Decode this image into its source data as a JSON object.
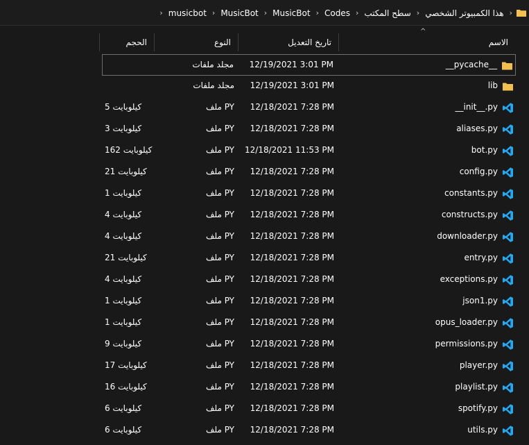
{
  "breadcrumb": {
    "items": [
      "هذا الكمبيوتر الشخصي",
      "سطح المكتب",
      "Codes",
      "MusicBot",
      "MusicBot",
      "musicbot"
    ],
    "separator": "›",
    "trailing_chevron": "›"
  },
  "columns": {
    "name": "الاسم",
    "date": "تاريخ التعديل",
    "type": "النوع",
    "size": "الحجم",
    "sort_indicator": "^"
  },
  "colors": {
    "background": "#191919",
    "folder": "#f2c14e",
    "vscode_blue": "#23a9f2",
    "selection_border": "#707070"
  },
  "files": [
    {
      "name": "__pycache__",
      "date": "12/19/2021 3:01 PM",
      "type": "مجلد ملفات",
      "size": "",
      "icon": "folder-icon",
      "selected": true
    },
    {
      "name": "lib",
      "date": "12/19/2021 3:01 PM",
      "type": "مجلد ملفات",
      "size": "",
      "icon": "folder-icon"
    },
    {
      "name": "__init__.py",
      "date": "12/18/2021 7:28 PM",
      "type": "ملف PY",
      "size": "5 كيلوبايت",
      "icon": "vscode-file-icon"
    },
    {
      "name": "aliases.py",
      "date": "12/18/2021 7:28 PM",
      "type": "ملف PY",
      "size": "3 كيلوبايت",
      "icon": "vscode-file-icon"
    },
    {
      "name": "bot.py",
      "date": "12/18/2021 11:53 PM",
      "type": "ملف PY",
      "size": "162 كيلوبايت",
      "icon": "vscode-file-icon"
    },
    {
      "name": "config.py",
      "date": "12/18/2021 7:28 PM",
      "type": "ملف PY",
      "size": "21 كيلوبايت",
      "icon": "vscode-file-icon"
    },
    {
      "name": "constants.py",
      "date": "12/18/2021 7:28 PM",
      "type": "ملف PY",
      "size": "1 كيلوبايت",
      "icon": "vscode-file-icon"
    },
    {
      "name": "constructs.py",
      "date": "12/18/2021 7:28 PM",
      "type": "ملف PY",
      "size": "4 كيلوبايت",
      "icon": "vscode-file-icon"
    },
    {
      "name": "downloader.py",
      "date": "12/18/2021 7:28 PM",
      "type": "ملف PY",
      "size": "4 كيلوبايت",
      "icon": "vscode-file-icon"
    },
    {
      "name": "entry.py",
      "date": "12/18/2021 7:28 PM",
      "type": "ملف PY",
      "size": "21 كيلوبايت",
      "icon": "vscode-file-icon"
    },
    {
      "name": "exceptions.py",
      "date": "12/18/2021 7:28 PM",
      "type": "ملف PY",
      "size": "4 كيلوبايت",
      "icon": "vscode-file-icon"
    },
    {
      "name": "json1.py",
      "date": "12/18/2021 7:28 PM",
      "type": "ملف PY",
      "size": "1 كيلوبايت",
      "icon": "vscode-file-icon"
    },
    {
      "name": "opus_loader.py",
      "date": "12/18/2021 7:28 PM",
      "type": "ملف PY",
      "size": "1 كيلوبايت",
      "icon": "vscode-file-icon"
    },
    {
      "name": "permissions.py",
      "date": "12/18/2021 7:28 PM",
      "type": "ملف PY",
      "size": "9 كيلوبايت",
      "icon": "vscode-file-icon"
    },
    {
      "name": "player.py",
      "date": "12/18/2021 7:28 PM",
      "type": "ملف PY",
      "size": "17 كيلوبايت",
      "icon": "vscode-file-icon"
    },
    {
      "name": "playlist.py",
      "date": "12/18/2021 7:28 PM",
      "type": "ملف PY",
      "size": "16 كيلوبايت",
      "icon": "vscode-file-icon"
    },
    {
      "name": "spotify.py",
      "date": "12/18/2021 7:28 PM",
      "type": "ملف PY",
      "size": "6 كيلوبايت",
      "icon": "vscode-file-icon"
    },
    {
      "name": "utils.py",
      "date": "12/18/2021 7:28 PM",
      "type": "ملف PY",
      "size": "6 كيلوبايت",
      "icon": "vscode-file-icon"
    }
  ]
}
